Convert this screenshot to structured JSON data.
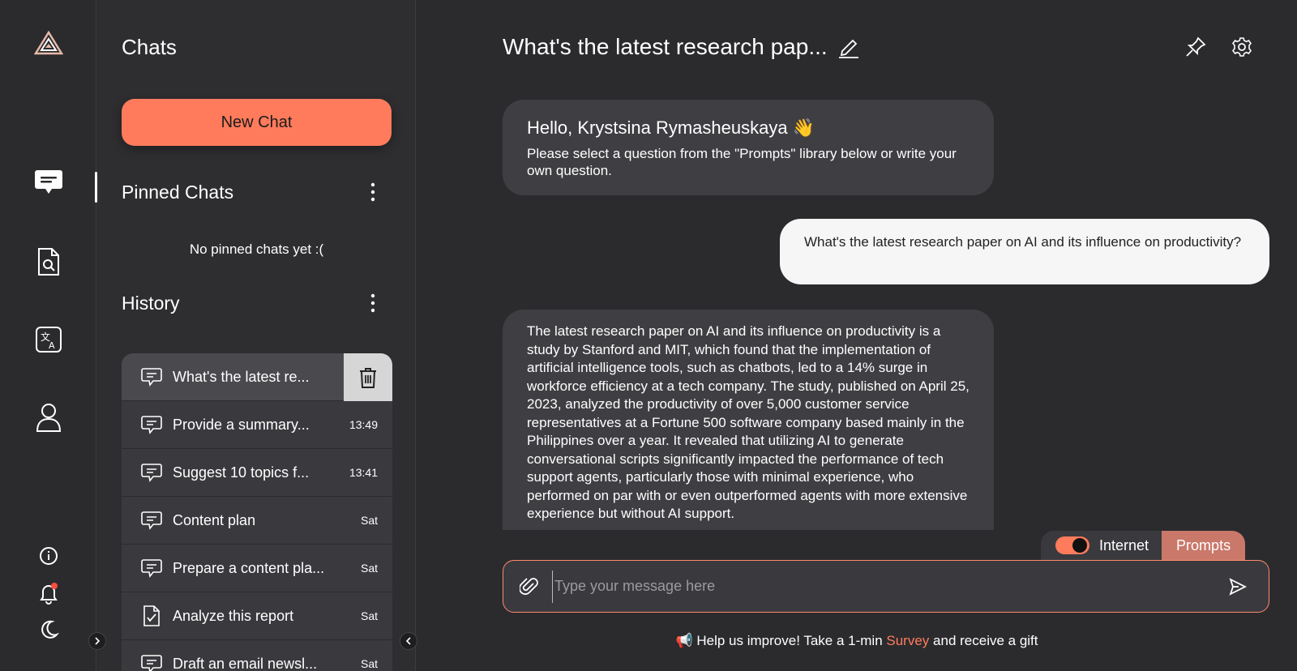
{
  "sidebar": {
    "logo": "triangle-logo-icon",
    "nav": [
      {
        "name": "chat-icon",
        "active": true
      },
      {
        "name": "document-search-icon",
        "active": false
      },
      {
        "name": "translate-icon",
        "active": false
      },
      {
        "name": "user-icon",
        "active": false
      }
    ],
    "bottom": [
      "info-icon",
      "bell-icon",
      "moon-icon"
    ],
    "notification_dot_color": "#ff4d3d"
  },
  "chats_panel": {
    "title": "Chats",
    "new_chat_label": "New Chat",
    "pinned": {
      "title": "Pinned Chats",
      "empty_text": "No pinned chats yet :("
    },
    "history": {
      "title": "History",
      "items": [
        {
          "label": "What's the latest re...",
          "time": "",
          "icon": "chat-bubble-icon",
          "active": true
        },
        {
          "label": "Provide a summary...",
          "time": "13:49",
          "icon": "chat-bubble-icon"
        },
        {
          "label": "Suggest 10 topics f...",
          "time": "13:41",
          "icon": "chat-bubble-icon"
        },
        {
          "label": "Content plan",
          "time": "Sat",
          "icon": "chat-bubble-icon"
        },
        {
          "label": "Prepare a content pla...",
          "time": "Sat",
          "icon": "chat-bubble-icon"
        },
        {
          "label": "Analyze this report",
          "time": "Sat",
          "icon": "document-check-icon"
        },
        {
          "label": "Draft an email newsl...",
          "time": "Sat",
          "icon": "chat-bubble-icon"
        }
      ]
    }
  },
  "main": {
    "chat_title": "What's the latest research pap...",
    "greeting": {
      "title": "Hello, Krystsina Rymasheuskaya 👋",
      "text": "Please select a question from the \"Prompts\" library below or write your own question."
    },
    "user_message": "What's the latest research paper on AI and its influence on productivity?",
    "assistant_message": "The latest research paper on AI and its influence on productivity is a study by Stanford and MIT, which found that the implementation of artificial intelligence tools, such as chatbots, led to a 14% surge in workforce efficiency at a tech company. The study, published on April 25, 2023, analyzed the productivity of over 5,000 customer service representatives at a Fortune 500 software company based mainly in the Philippines over a year. It revealed that utilizing AI to generate conversational scripts significantly impacted the performance of tech support agents, particularly those with minimal experience, who performed on par with or even outperformed agents with more extensive experience but without AI support.",
    "internet_label": "Internet",
    "internet_enabled": true,
    "prompts_label": "Prompts",
    "input_placeholder": "Type your message here",
    "footer": {
      "prefix": "📢 Help us improve! Take a 1-min ",
      "link": "Survey",
      "suffix": " and receive a gift"
    }
  },
  "colors": {
    "accent": "#ff7b5c",
    "prompts_tab": "#c9786a",
    "background": "#2b2b2e",
    "bubble": "#3f3f43"
  }
}
